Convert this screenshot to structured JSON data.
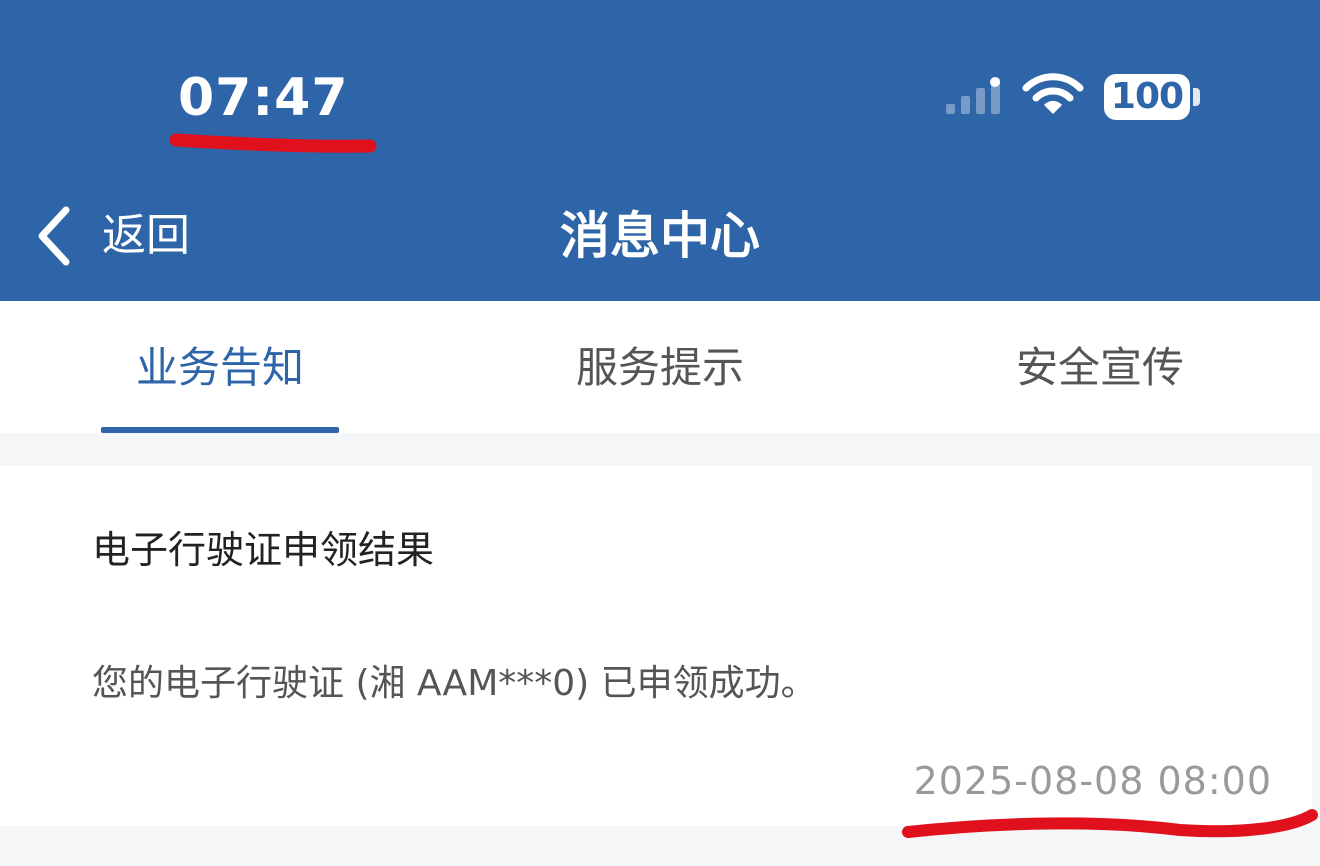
{
  "status_bar": {
    "time": "07:47",
    "battery": "100",
    "icons": [
      "signal-icon",
      "wifi-icon",
      "battery-icon"
    ]
  },
  "header": {
    "back_label": "返回",
    "title": "消息中心"
  },
  "tabs": [
    {
      "label": "业务告知",
      "active": true
    },
    {
      "label": "服务提示",
      "active": false
    },
    {
      "label": "安全宣传",
      "active": false
    }
  ],
  "messages": [
    {
      "title": "电子行驶证申领结果",
      "body": "您的电子行驶证 (湘 AAM***0) 已申领成功。",
      "time": "2025-08-08 08:00"
    }
  ],
  "colors": {
    "brand": "#2e64a8",
    "annotation": "#e0101c",
    "background": "#f4f6f8"
  }
}
